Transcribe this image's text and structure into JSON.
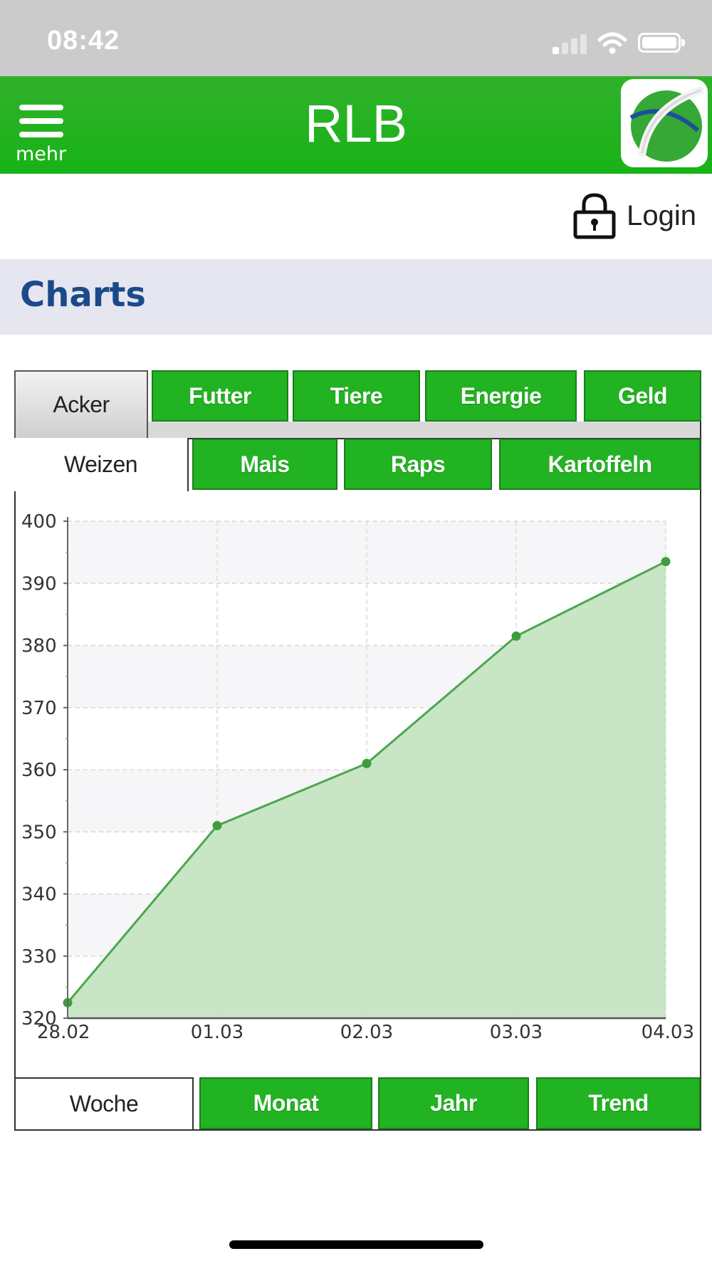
{
  "status_bar": {
    "time": "08:42"
  },
  "header": {
    "menu_label": "mehr",
    "title": "RLB"
  },
  "login": {
    "label": "Login"
  },
  "section": {
    "title": "Charts"
  },
  "category_tabs": [
    {
      "label": "Acker",
      "active": true
    },
    {
      "label": "Futter",
      "active": false
    },
    {
      "label": "Tiere",
      "active": false
    },
    {
      "label": "Energie",
      "active": false
    },
    {
      "label": "Geld",
      "active": false
    }
  ],
  "product_tabs": [
    {
      "label": "Weizen",
      "active": true
    },
    {
      "label": "Mais",
      "active": false
    },
    {
      "label": "Raps",
      "active": false
    },
    {
      "label": "Kartoffeln",
      "active": false
    }
  ],
  "period_tabs": [
    {
      "label": "Woche",
      "active": true
    },
    {
      "label": "Monat",
      "active": false
    },
    {
      "label": "Jahr",
      "active": false
    },
    {
      "label": "Trend",
      "active": false
    }
  ],
  "colors": {
    "header_green": "#1db51b",
    "tab_green": "#21b321",
    "title_blue": "#1b4a8a",
    "section_bg": "#e6e6f0",
    "series_line": "#4ca64c",
    "series_fill": "#c5e4c2"
  },
  "chart_data": {
    "type": "area",
    "categories": [
      "28.02",
      "01.03",
      "02.03",
      "03.03",
      "04.03"
    ],
    "values": [
      322.5,
      351,
      361,
      381.5,
      393.5
    ],
    "ylim": [
      320,
      400
    ],
    "yticks": [
      320,
      330,
      340,
      350,
      360,
      370,
      380,
      390,
      400
    ],
    "grid": true,
    "legend": "none"
  }
}
